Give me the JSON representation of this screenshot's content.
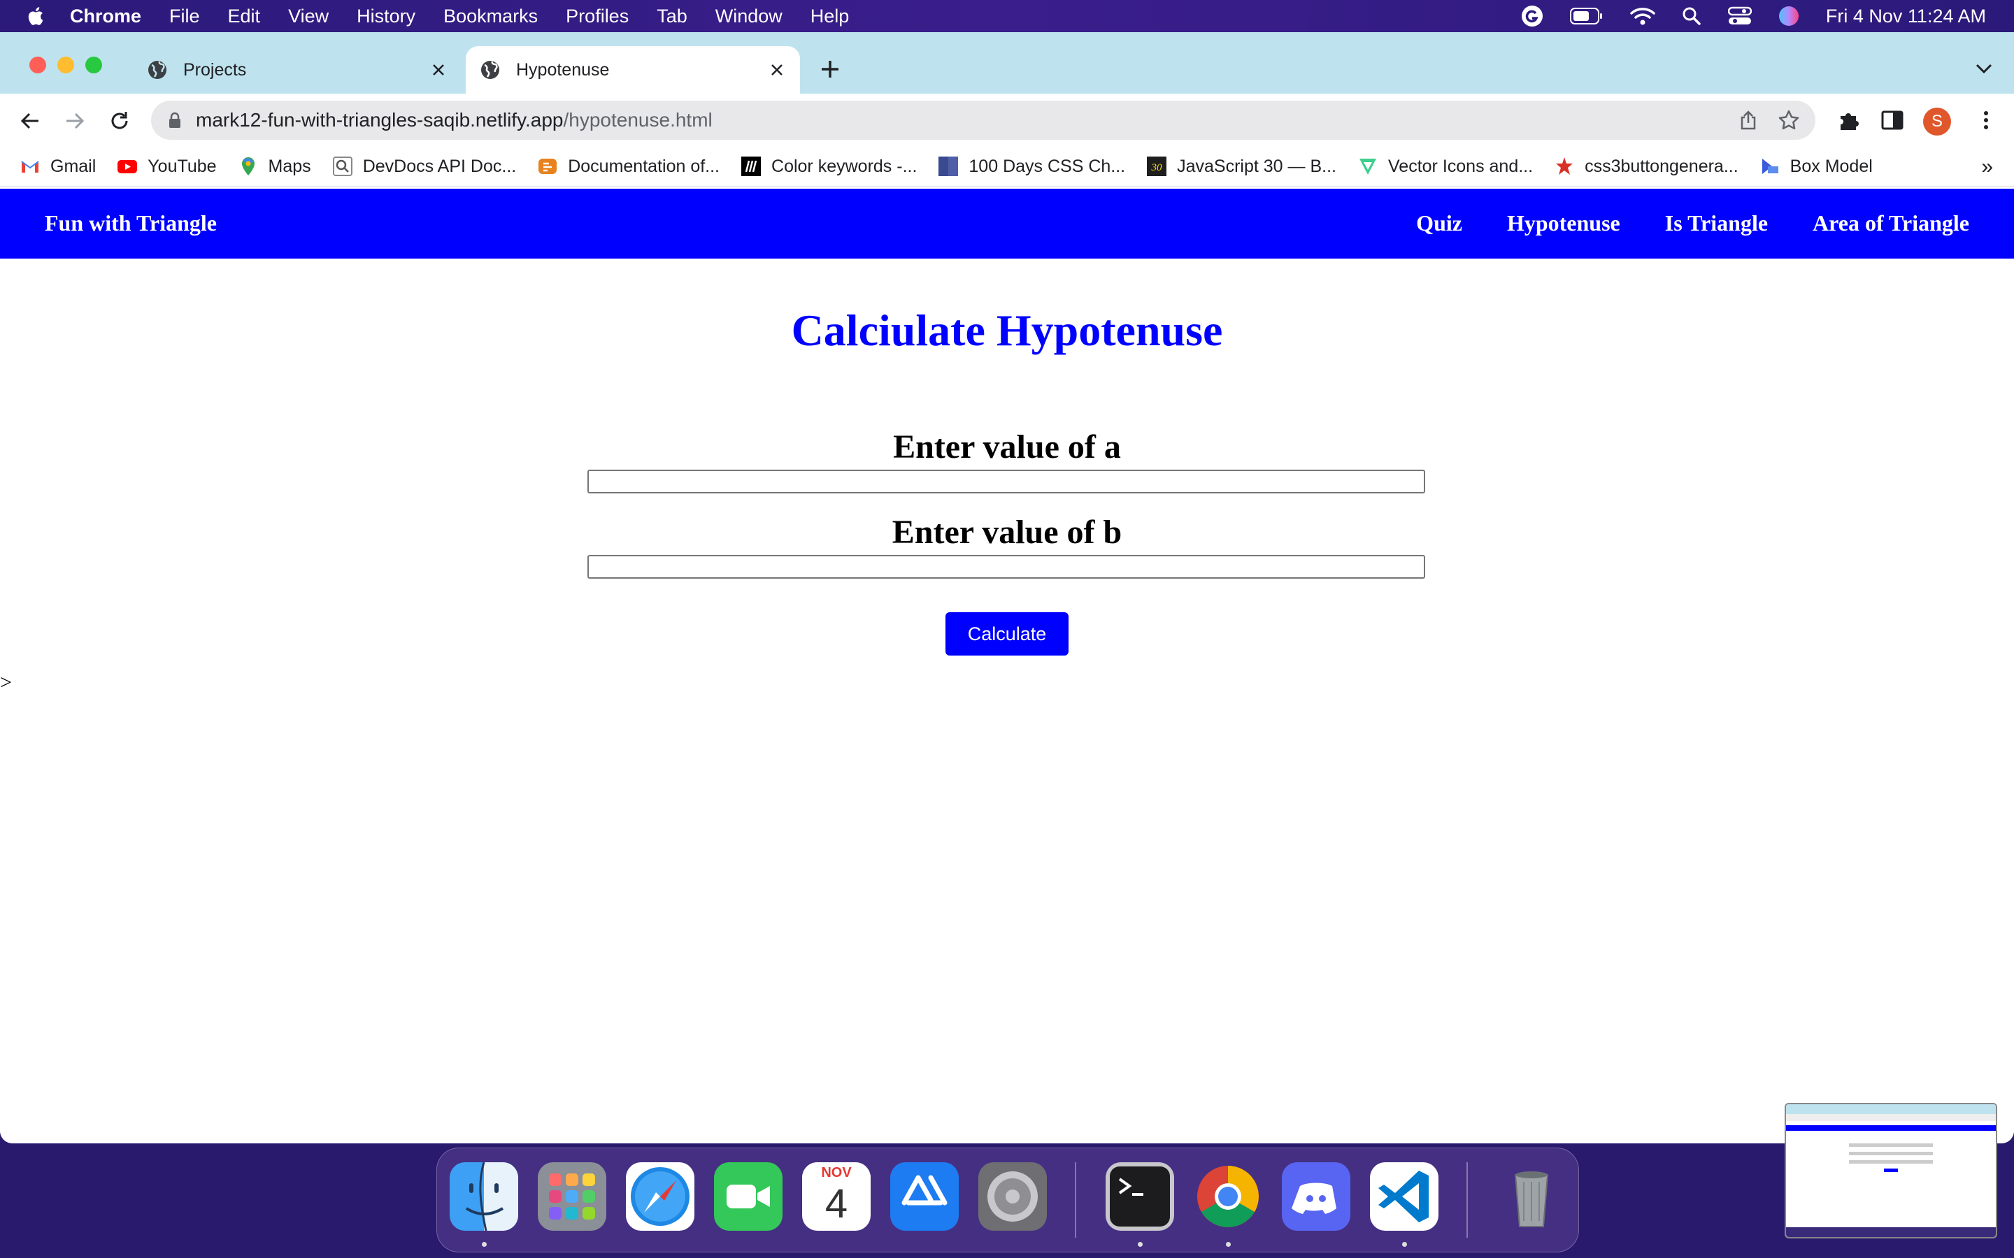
{
  "menubar": {
    "app_name": "Chrome",
    "items": [
      "File",
      "Edit",
      "View",
      "History",
      "Bookmarks",
      "Profiles",
      "Tab",
      "Window",
      "Help"
    ],
    "clock": "Fri 4 Nov  11:24 AM"
  },
  "tabs": [
    {
      "title": "Projects",
      "active": false
    },
    {
      "title": "Hypotenuse",
      "active": true
    }
  ],
  "address_bar": {
    "host": "mark12-fun-with-triangles-saqib.netlify.app",
    "path": "/hypotenuse.html"
  },
  "profile_initial": "S",
  "bookmarks": [
    {
      "label": "Gmail",
      "icon": "gmail-icon"
    },
    {
      "label": "YouTube",
      "icon": "youtube-icon"
    },
    {
      "label": "Maps",
      "icon": "maps-icon"
    },
    {
      "label": "DevDocs API Doc...",
      "icon": "devdocs-icon"
    },
    {
      "label": "Documentation of...",
      "icon": "docs-icon"
    },
    {
      "label": "Color keywords -...",
      "icon": "mdn-icon"
    },
    {
      "label": "100 Days CSS Ch...",
      "icon": "css-icon"
    },
    {
      "label": "JavaScript 30 — B...",
      "icon": "js30-icon"
    },
    {
      "label": "Vector Icons and...",
      "icon": "vector-icon"
    },
    {
      "label": "css3buttongenera...",
      "icon": "star-icon"
    },
    {
      "label": "Box Model",
      "icon": "box-icon"
    }
  ],
  "bookmarks_overflow": "»",
  "site": {
    "brand": "Fun with Triangle",
    "nav": [
      "Quiz",
      "Hypotenuse",
      "Is Triangle",
      "Area of Triangle"
    ],
    "nav_color": "#0000ff"
  },
  "page": {
    "title": "Calciulate Hypotenuse",
    "label_a": "Enter value of a",
    "label_b": "Enter value of b",
    "input_a_value": "",
    "input_b_value": "",
    "button_label": "Calculate",
    "stray_text": ">"
  },
  "dock": {
    "apps": [
      "finder",
      "launchpad",
      "safari",
      "facetime",
      "calendar",
      "app-store",
      "system-preferences",
      "terminal",
      "chrome",
      "discord",
      "vscode",
      "trash"
    ],
    "calendar_month": "NOV",
    "calendar_day": "4"
  }
}
